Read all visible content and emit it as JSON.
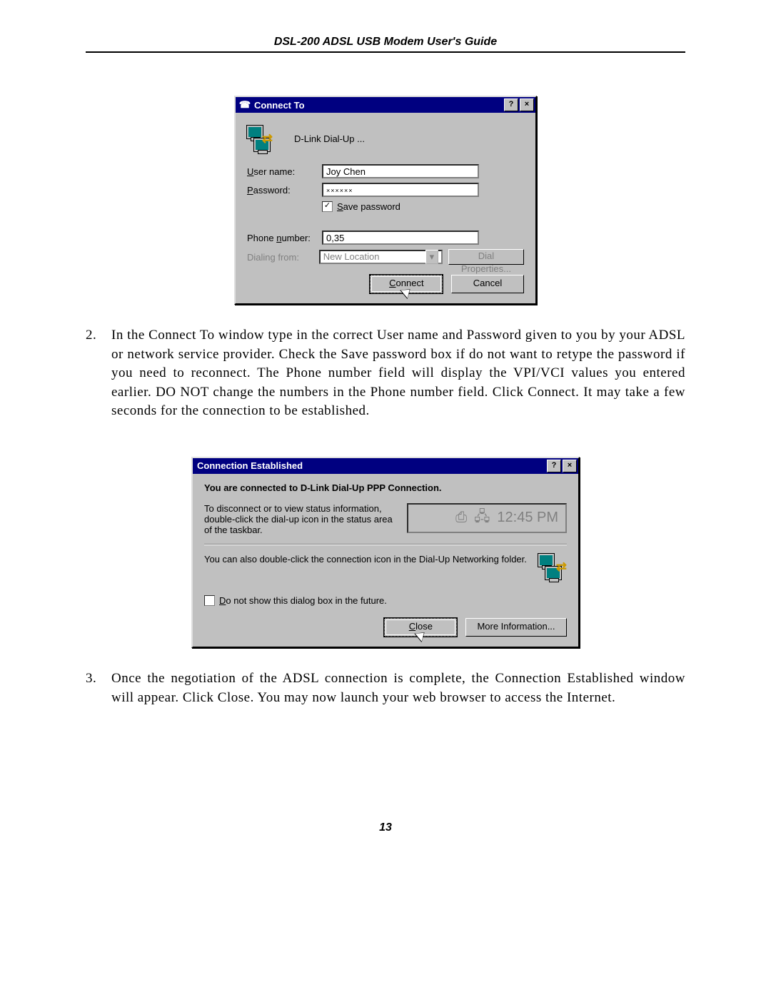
{
  "doc": {
    "header": "DSL-200 ADSL USB Modem User's Guide",
    "page_number": "13"
  },
  "step2": {
    "number": "2.",
    "text": "In the Connect To window type in the correct User name and Password given to you by your ADSL or network service provider. Check the Save password box if do not want to retype the password if you need to reconnect. The Phone number field will display the VPI/VCI values you entered earlier. DO NOT change the numbers in the Phone number field.  Click Connect. It may take a few seconds for the connection to be established."
  },
  "step3": {
    "number": "3.",
    "text": "Once the negotiation of the ADSL connection is complete, the Connection Established window will appear. Click Close. You may now launch your web browser to access the Internet."
  },
  "dlg1": {
    "title": "Connect To",
    "connection_name": "D-Link Dial-Up ...",
    "user_label_pre": "U",
    "user_label_post": "ser name:",
    "pass_label_pre": "P",
    "pass_label_post": "assword:",
    "user_value": "Joy Chen",
    "pass_value": "××××××",
    "save_pre": "S",
    "save_post": "ave password",
    "phone_label_pre": "Phone ",
    "phone_label_u": "n",
    "phone_label_post": "umber:",
    "phone_value": "0,35",
    "dial_from_label": "Dialing from:",
    "dial_from_value": "New Location",
    "dial_props": "Dial Properties...",
    "connect_pre": "C",
    "connect_post": "onnect",
    "cancel": "Cancel",
    "help_btn": "?",
    "close_btn": "×"
  },
  "dlg2": {
    "title": "Connection Established",
    "headline": "You are connected to D-Link Dial-Up PPP Connection.",
    "para1": "To disconnect or to view status information, double-click the dial-up icon in the status area of the taskbar.",
    "para2": "You can also double-click the connection icon in the Dial-Up Networking folder.",
    "time": "12:45 PM",
    "dont_show_pre": "D",
    "dont_show_post": "o not show this dialog box in the future.",
    "close_pre": "C",
    "close_post": "lose",
    "more_info": "More Information...",
    "help_btn": "?",
    "close_btn": "×"
  }
}
